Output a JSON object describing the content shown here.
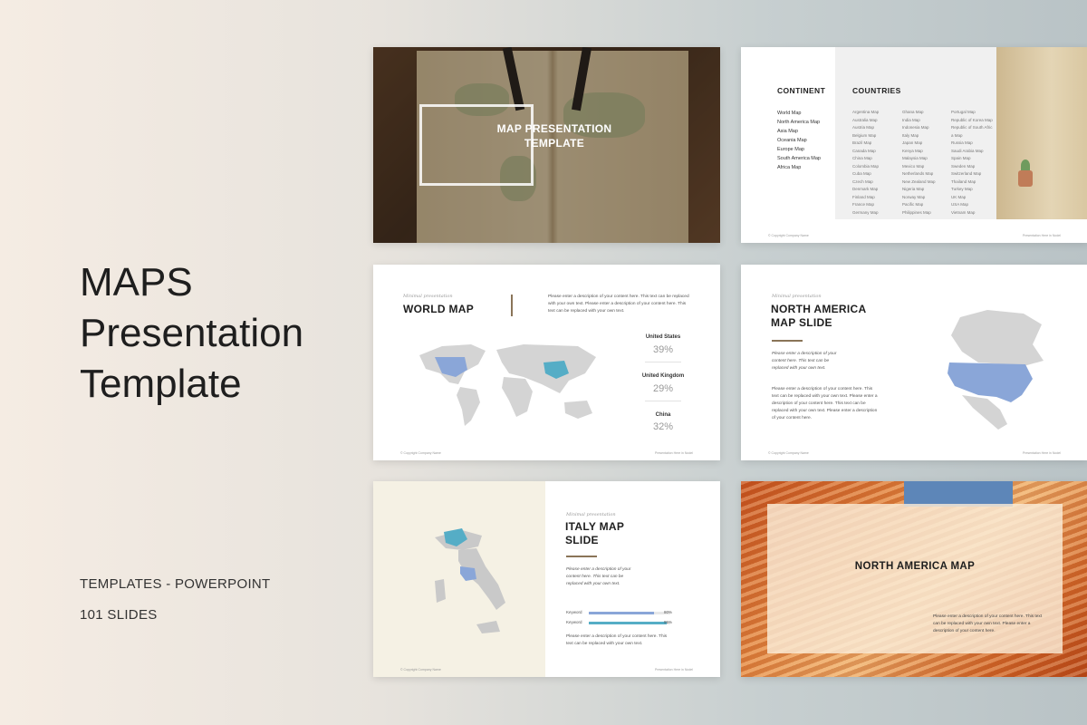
{
  "hero": {
    "title_lines": [
      "MAPS",
      "Presentation",
      "Template"
    ],
    "category": "TEMPLATES - POWERPOINT",
    "slide_count": "101 SLIDES"
  },
  "slide1": {
    "title_line1": "MAP PRESENTATION",
    "title_line2": "TEMPLATE"
  },
  "slide2": {
    "continent_heading": "CONTINENT",
    "countries_heading": "COUNTRIES",
    "continents": [
      "World Map",
      "North America Map",
      "Asia Map",
      "Oceania Map",
      "Europe Map",
      "South America Map",
      "Africa Map"
    ],
    "countries_col1": [
      "Argentina Map",
      "Australia Map",
      "Austria Map",
      "Belgium Map",
      "Brazil Map",
      "Canada Map",
      "China Map",
      "Colombia Map",
      "Cuba Map",
      "Czech Map",
      "Denmark Map",
      "Finland Map",
      "France Map",
      "Germany Map"
    ],
    "countries_col2": [
      "Ghana Map",
      "India Map",
      "Indonesia Map",
      "Italy Map",
      "Japan Map",
      "Kenya Map",
      "Malaysia Map",
      "Mexico Map",
      "Netherlands Map",
      "New Zealand Map",
      "Nigeria Map",
      "Norway Map",
      "Pacific Map",
      "Philippines Map"
    ],
    "countries_col3": [
      "Portugal Map",
      "Republic of Korea Map",
      "Republic of South Afric",
      "a Map",
      "Russia Map",
      "Saudi Arabia Map",
      "Spain Map",
      "Sweden Map",
      "Switzerland Map",
      "Thailand Map",
      "Turkey Map",
      "UK Map",
      "USA Map",
      "Vietnam Map"
    ],
    "footer_left": "© Copyright Company Name",
    "footer_right": "Presentation Here in Nodel"
  },
  "slide3": {
    "kicker": "Minimal presentation",
    "title": "WORLD MAP",
    "description": "Please enter a description of your content here. This text can be replaced with your own text. Please enter a description of your content here. This text can be replaced with your own text.",
    "stats": [
      {
        "name": "United States",
        "value": "39%"
      },
      {
        "name": "United Kingdom",
        "value": "29%"
      },
      {
        "name": "China",
        "value": "32%"
      }
    ],
    "footer_left": "© Copyright Company Name",
    "footer_right": "Presentation Here in Nodel"
  },
  "slide4": {
    "kicker": "Minimal presentation",
    "title_line1": "NORTH AMERICA",
    "title_line2": "MAP SLIDE",
    "intro": "Please enter a description of your content here. This text can be replaced with your own text.",
    "body": "Please enter a description of your content here. This text can be replaced with your own text. Please enter a description of your content here. This text can be replaced with your own text. Please enter a description of your content here.",
    "footer_left": "© Copyright Company Name",
    "footer_right": "Presentation Here in Nodel"
  },
  "slide5": {
    "kicker": "Minimal presentation",
    "title_line1": "ITALY MAP",
    "title_line2": "SLIDE",
    "intro": "Please enter a description of your content here. This text can be replaced with your own text.",
    "keywords": [
      {
        "label": "Keyword",
        "value": 0.8,
        "pct": "80%",
        "color": "#8aa6d8"
      },
      {
        "label": "Keyword",
        "value": 0.95,
        "pct": "95%",
        "color": "#55adc6"
      }
    ],
    "body": "Please enter a description of your content here. This text can be replaced with your own text.",
    "footer_left": "© Copyright Company Name",
    "footer_right": "Presentation Here in Nodel"
  },
  "slide6": {
    "title": "NORTH AMERICA MAP",
    "description": "Please enter a description of your content here. This text can be replaced with your own text. Please enter a description of your content here."
  },
  "colors": {
    "highlight_blue": "#8aa6d8",
    "highlight_teal": "#55adc6",
    "map_gray": "#d4d4d4",
    "accent_brown": "#8a7458"
  }
}
